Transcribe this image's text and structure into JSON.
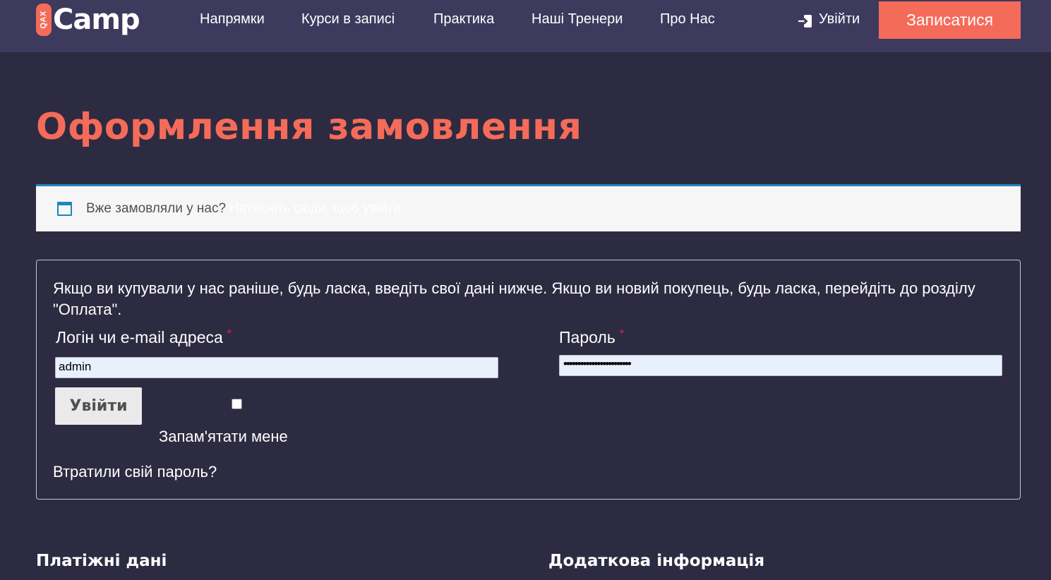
{
  "header": {
    "logo_badge": "QAX",
    "logo_text": "Camp",
    "nav": [
      "Напрямки",
      "Курси в записі",
      "Практика",
      "Наші Тренери",
      "Про Нас"
    ],
    "login_label": "Увійти",
    "cta_label": "Записатися"
  },
  "page": {
    "title": "Оформлення замовлення"
  },
  "notice": {
    "text": "Вже замовляли у нас?",
    "link": "Натисніть сюди, щоб увійти"
  },
  "login_form": {
    "intro": "Якщо ви купували у нас раніше, будь ласка, введіть свої дані нижче. Якщо ви новий покупець, будь ласка, перейдіть до розділу \"Оплата\".",
    "username_label": "Логін чи e-mail адреса",
    "username_value": "admin",
    "password_label": "Пароль",
    "password_value": "••••••••••••••••••••••••",
    "required_mark": "*",
    "submit_label": "Увійти",
    "remember_label": "Запам'ятати мене",
    "lost_password": "Втратили свій пароль?"
  },
  "sections": {
    "billing": "Платіжні дані",
    "additional": "Додаткова інформація"
  },
  "colors": {
    "background": "#2d2b41",
    "header": "#3d3a5e",
    "accent": "#f56b5a",
    "notice_border": "#1e85be"
  }
}
